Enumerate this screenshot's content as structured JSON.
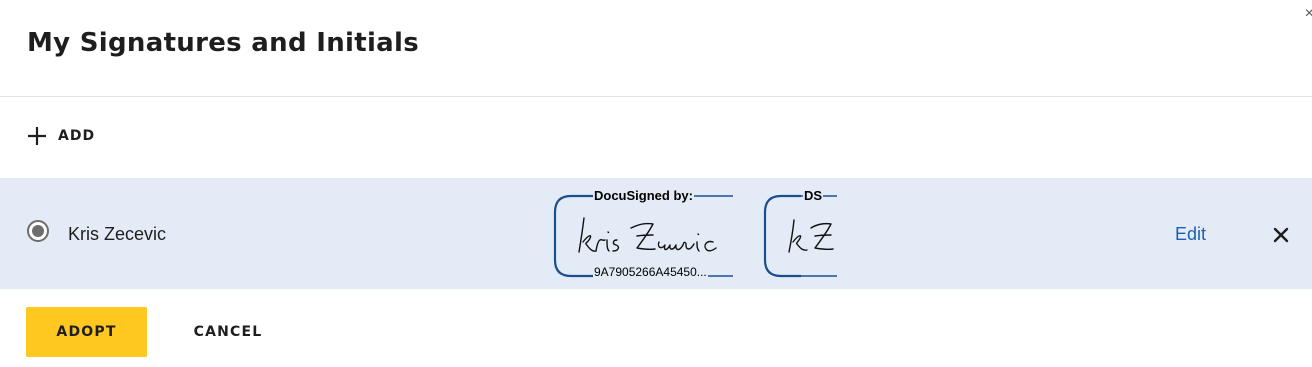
{
  "dialog": {
    "title": "My Signatures and Initials",
    "close_icon": "close-icon"
  },
  "toolbar": {
    "add_label": "ADD",
    "add_icon": "plus-icon"
  },
  "signature_row": {
    "name": "Kris Zecevic",
    "selected": true,
    "signature_stamp_header": "DocuSigned by:",
    "signature_stamp_id": "9A7905266A45450...",
    "initials_stamp_header": "DS",
    "edit_label": "Edit",
    "remove_icon": "close-icon"
  },
  "footer": {
    "adopt_label": "ADOPT",
    "cancel_label": "CANCEL"
  },
  "colors": {
    "row_background": "#e3ecf6",
    "stamp_frame": "#1c4e8c",
    "link": "#1d5fb4",
    "primary_button": "#ffc820"
  }
}
